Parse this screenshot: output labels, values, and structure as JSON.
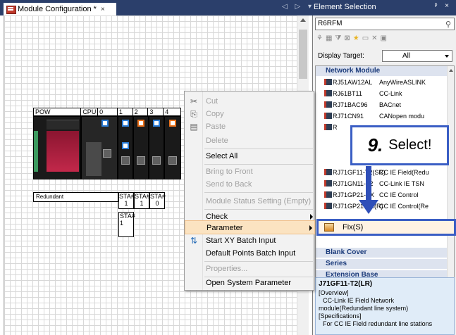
{
  "header": {
    "tab_title": "Module Configuration * ",
    "tab_close": "×",
    "doc_controls": "◁ ▷ ▾",
    "panel_title": "Element Selection",
    "panel_controls": "ᵖ ×"
  },
  "rack": {
    "slot_headers": [
      "POW",
      "CPU",
      "0",
      "1",
      "2",
      "3",
      "4"
    ],
    "redundant_label": "Redundant",
    "sta_labels": [
      "STA#\n1",
      "STA#\n1",
      "STA#\n0"
    ],
    "sta_extra": "STA#\n1"
  },
  "context_menu": {
    "items": [
      {
        "label": "Cut",
        "disabled": true,
        "icon": "scissors-icon"
      },
      {
        "label": "Copy",
        "disabled": true,
        "icon": "copy-icon"
      },
      {
        "label": "Paste",
        "disabled": true,
        "icon": "paste-icon"
      },
      {
        "label": "Delete",
        "disabled": true
      },
      {
        "label": "Select All",
        "disabled": false
      },
      {
        "label": "Bring to Front",
        "disabled": true
      },
      {
        "label": "Send to Back",
        "disabled": true
      },
      {
        "label": "Module Status Setting (Empty)",
        "disabled": true
      },
      {
        "label": "Check",
        "disabled": false,
        "submenu": true
      },
      {
        "label": "Parameter",
        "disabled": false,
        "submenu": true,
        "highlighted": true
      },
      {
        "label": "Start XY Batch Input",
        "disabled": false,
        "icon": "xy-batch-icon"
      },
      {
        "label": "Default Points Batch Input",
        "disabled": false
      },
      {
        "label": "Properties...",
        "disabled": true
      },
      {
        "label": "Open System Parameter",
        "disabled": false
      }
    ]
  },
  "element_panel": {
    "search_value": "R6RFM",
    "display_target_label": "Display Target:",
    "display_target_value": "All",
    "category_network": "Network Module",
    "rows": [
      {
        "name": "RJ51AW12AL",
        "type": "AnyWireASLINK"
      },
      {
        "name": "RJ61BT11",
        "type": "CC-Link"
      },
      {
        "name": "RJ71BAC96",
        "type": "BACnet"
      },
      {
        "name": "RJ71CN91",
        "type": "CANopen modu"
      },
      {
        "name": "R",
        "type": "t"
      },
      {
        "name": "",
        "type": ""
      },
      {
        "name": "",
        "type": ""
      },
      {
        "name": "RJ71GF11-T2(SR)",
        "type": "CC IE Field(Redu"
      },
      {
        "name": "RJ71GN11-T2",
        "type": "CC-Link IE TSN"
      },
      {
        "name": "RJ71GP21-SX",
        "type": "CC IE Control"
      },
      {
        "name": "RJ71GP21-SX(R)",
        "type": "CC IE Control(Re"
      }
    ],
    "category_blank": "Blank Cover",
    "category_series": "Series",
    "category_extension": "Extension Base",
    "info_title": "J71GF11-T2(LR)",
    "info_lines": [
      "[Overview]",
      "CC-Link IE Field Network",
      "module(Redundant line system)",
      "[Specifications]",
      "For CC IE Field redundant line stations"
    ]
  },
  "submenu": {
    "fix_label": "Fix(S)"
  },
  "annotation": {
    "step_number": "9.",
    "step_text": "Select!"
  },
  "colors": {
    "header_bg": "#2b3f6b",
    "annotation_blue": "#3a5ec4",
    "menu_highlight": "#fbe3c1",
    "module_red": "#c2284a"
  }
}
